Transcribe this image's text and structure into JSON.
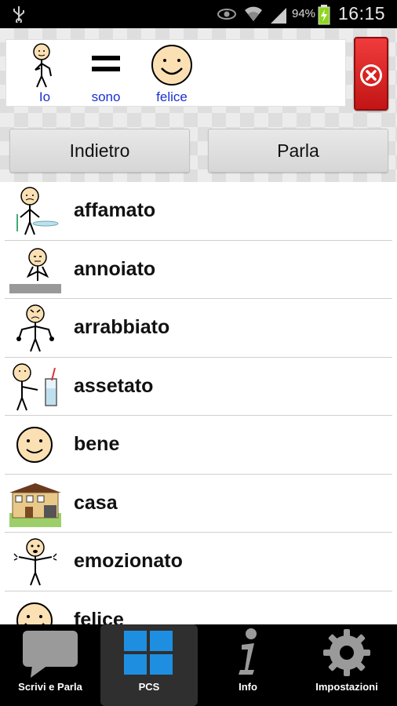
{
  "status_bar": {
    "battery_percent": "94%",
    "time": "16:15"
  },
  "sentence": {
    "symbols": [
      {
        "word": "Io"
      },
      {
        "word": "sono"
      },
      {
        "word": "felice"
      }
    ]
  },
  "buttons": {
    "back_label": "Indietro",
    "speak_label": "Parla"
  },
  "list": {
    "items": [
      {
        "label": "affamato"
      },
      {
        "label": "annoiato"
      },
      {
        "label": "arrabbiato"
      },
      {
        "label": "assetato"
      },
      {
        "label": "bene"
      },
      {
        "label": "casa"
      },
      {
        "label": "emozionato"
      },
      {
        "label": "felice"
      }
    ]
  },
  "tabs": [
    {
      "label": "Scrivi e Parla",
      "icon": "speech-bubble-icon"
    },
    {
      "label": "PCS",
      "icon": "grid-icon",
      "active": true
    },
    {
      "label": "Info",
      "icon": "info-icon"
    },
    {
      "label": "Impostazioni",
      "icon": "gear-icon"
    }
  ],
  "colors": {
    "symbol_text": "#1a2fd6",
    "clear_button": "#d92020",
    "pcs_tile": "#1e8fe0"
  }
}
